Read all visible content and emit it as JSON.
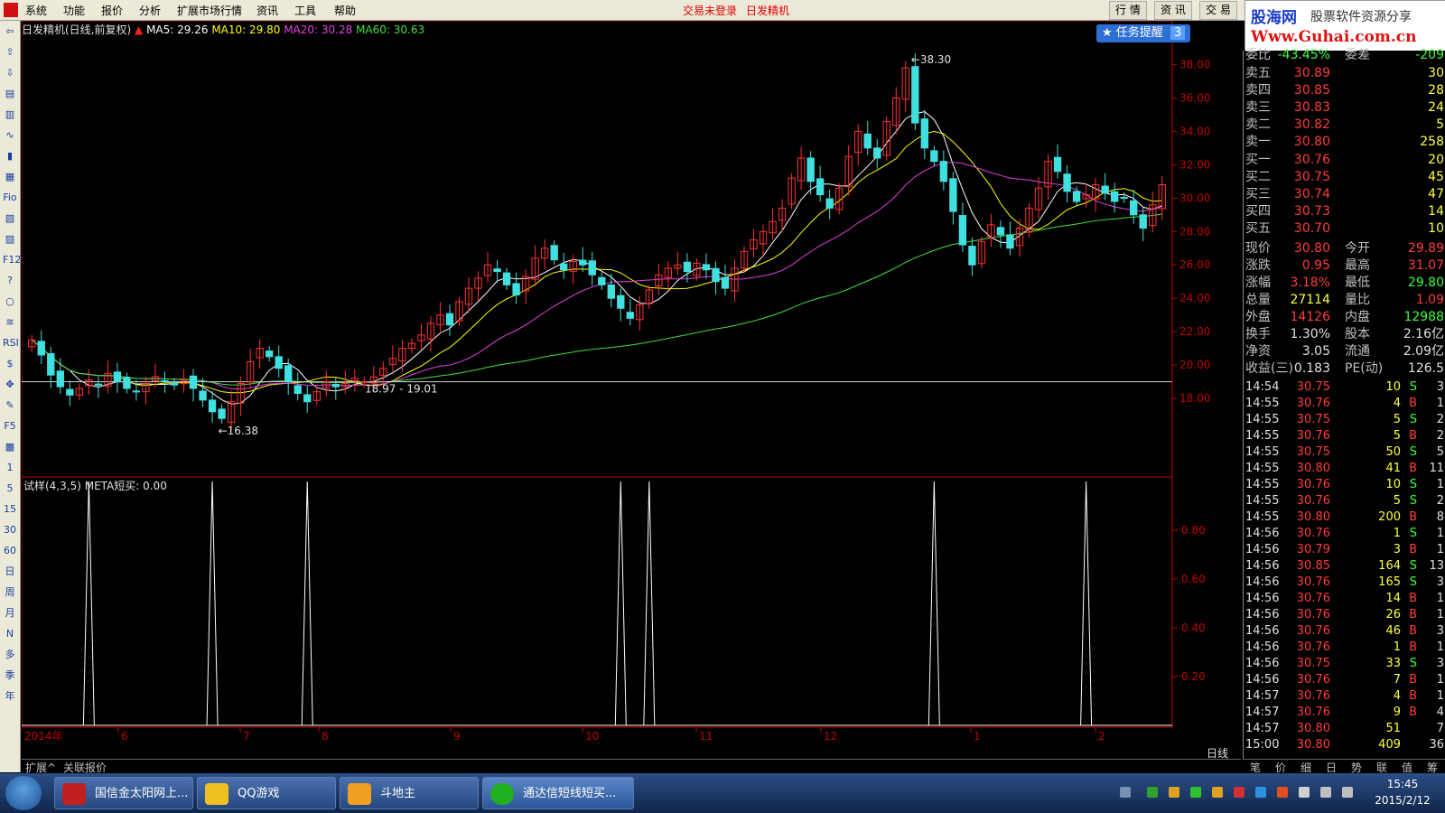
{
  "menu": {
    "items": [
      "系统",
      "功能",
      "报价",
      "分析",
      "扩展市场行情",
      "资讯",
      "工具",
      "帮助"
    ],
    "status_login": "交易未登录",
    "status_name": "日发精机",
    "right_tabs": [
      "行 情",
      "资 讯",
      "交 易"
    ]
  },
  "banner": {
    "line1": "股海网",
    "line1b": "股票软件资源分享",
    "line2": "Www.Guhai.com.cn"
  },
  "left_toolbar": [
    "⇦",
    "⇧",
    "⇩",
    "▤",
    "▥",
    "∿",
    "▮",
    "▦",
    "Fio",
    "▧",
    "▨",
    "F12",
    "?",
    "○",
    "≋",
    "RSI",
    "$",
    "✥",
    "✎",
    "F5",
    "▩",
    "1",
    "5",
    "15",
    "30",
    "60",
    "日",
    "周",
    "月",
    "N",
    "多",
    "季",
    "年"
  ],
  "chart": {
    "title": "日发精机(日线,前复权)",
    "ma5": "MA5: 29.26",
    "ma10": "MA10: 29.80",
    "ma20": "MA20: 30.28",
    "ma60": "MA60: 30.63",
    "task_label": "任务提醒",
    "task_count": "3",
    "high_label": "38.30",
    "low_label": "16.38",
    "range_label": "18.97 - 19.01",
    "indicator_label": "试样(4,3,5)  META短买: 0.00",
    "period_label": "日线",
    "colors": {
      "ma5": "#ffffff",
      "ma10": "#ffff00",
      "ma20": "#e040e0",
      "ma60": "#40e040",
      "up": "#ff3030",
      "down": "#40e0e0",
      "axis": "#c00000"
    }
  },
  "chart_data": [
    {
      "type": "candlestick",
      "title": "日发精机(日线,前复权)",
      "ylim": [
        16,
        39
      ],
      "y_ticks": [
        "38.00",
        "36.00",
        "34.00",
        "32.00",
        "30.00",
        "28.00",
        "26.00",
        "24.00",
        "22.00",
        "20.00",
        "18.00"
      ],
      "x_labels": [
        "2014年",
        "6",
        "7",
        "8",
        "9",
        "10",
        "11",
        "12",
        "1",
        "2"
      ],
      "close": [
        21.5,
        20.6,
        19.4,
        18.7,
        18.2,
        18.6,
        19.1,
        18.8,
        19.5,
        19.0,
        18.6,
        18.4,
        18.9,
        19.3,
        19.0,
        18.8,
        19.1,
        18.6,
        17.9,
        17.2,
        16.8,
        17.8,
        18.9,
        20.2,
        21.0,
        20.5,
        19.8,
        19.0,
        18.3,
        17.8,
        18.4,
        19.0,
        18.7,
        18.9,
        19.2,
        19.0,
        19.3,
        19.8,
        20.4,
        21.0,
        21.3,
        21.8,
        22.5,
        23.0,
        22.4,
        23.8,
        24.6,
        25.2,
        26.0,
        25.6,
        24.8,
        24.2,
        25.3,
        26.4,
        27.0,
        26.3,
        25.7,
        26.2,
        26.0,
        25.4,
        24.8,
        24.0,
        23.4,
        22.8,
        23.6,
        24.5,
        25.4,
        25.8,
        26.0,
        25.6,
        26.1,
        25.7,
        25.0,
        24.6,
        25.8,
        26.8,
        27.5,
        28.0,
        28.6,
        29.4,
        31.2,
        32.4,
        31.0,
        30.2,
        29.4,
        30.6,
        32.5,
        34.0,
        33.0,
        32.4,
        34.6,
        36.0,
        37.8,
        34.5,
        33.0,
        32.2,
        31.0,
        29.2,
        27.2,
        26.0,
        27.4,
        28.4,
        27.8,
        27.0,
        28.2,
        29.4,
        30.6,
        32.2,
        31.6,
        30.4,
        29.8,
        30.2,
        30.8,
        30.3,
        29.8,
        30.0,
        29.0,
        28.2,
        29.6,
        30.8
      ],
      "high": 38.3,
      "low": 16.38,
      "ma_values": {
        "MA5": 29.26,
        "MA10": 29.8,
        "MA20": 30.28,
        "MA60": 30.63
      }
    },
    {
      "type": "line",
      "title": "试样(4,3,5)  META短买: 0.00",
      "ylim": [
        0,
        1
      ],
      "y_ticks": [
        "0.80",
        "0.60",
        "0.40",
        "0.20"
      ],
      "spike_positions": [
        13,
        44,
        65,
        140,
        147,
        216,
        251
      ],
      "spike_value": 1.0
    }
  ],
  "quote": {
    "weibi": {
      "label": "委比",
      "value": "-43.45%",
      "label2": "委差",
      "value2": "-209"
    },
    "sell": [
      {
        "label": "卖五",
        "price": "30.89",
        "vol": "30"
      },
      {
        "label": "卖四",
        "price": "30.85",
        "vol": "28"
      },
      {
        "label": "卖三",
        "price": "30.83",
        "vol": "24"
      },
      {
        "label": "卖二",
        "price": "30.82",
        "vol": "5"
      },
      {
        "label": "卖一",
        "price": "30.80",
        "vol": "258"
      }
    ],
    "buy": [
      {
        "label": "买一",
        "price": "30.76",
        "vol": "20"
      },
      {
        "label": "买二",
        "price": "30.75",
        "vol": "45"
      },
      {
        "label": "买三",
        "price": "30.74",
        "vol": "47"
      },
      {
        "label": "买四",
        "price": "30.73",
        "vol": "14"
      },
      {
        "label": "买五",
        "price": "30.70",
        "vol": "10"
      }
    ],
    "stats": [
      {
        "l1": "现价",
        "v1": "30.80",
        "c1": "red",
        "l2": "今开",
        "v2": "29.89",
        "c2": "red"
      },
      {
        "l1": "涨跌",
        "v1": "0.95",
        "c1": "red",
        "l2": "最高",
        "v2": "31.07",
        "c2": "red"
      },
      {
        "l1": "涨幅",
        "v1": "3.18%",
        "c1": "red",
        "l2": "最低",
        "v2": "29.80",
        "c2": "grn"
      },
      {
        "l1": "总量",
        "v1": "27114",
        "c1": "yel",
        "l2": "量比",
        "v2": "1.09",
        "c2": "red"
      },
      {
        "l1": "外盘",
        "v1": "14126",
        "c1": "red",
        "l2": "内盘",
        "v2": "12988",
        "c2": "grn"
      },
      {
        "l1": "换手",
        "v1": "1.30%",
        "c1": "wht",
        "l2": "股本",
        "v2": "2.16亿",
        "c2": "wht"
      },
      {
        "l1": "净资",
        "v1": "3.05",
        "c1": "wht",
        "l2": "流通",
        "v2": "2.09亿",
        "c2": "wht"
      },
      {
        "l1": "收益(三)",
        "v1": "0.183",
        "c1": "wht",
        "l2": "PE(动)",
        "v2": "126.5",
        "c2": "wht"
      }
    ],
    "ticks": [
      {
        "t": "14:54",
        "p": "30.75",
        "v": "10",
        "s": "S",
        "n": "3"
      },
      {
        "t": "14:55",
        "p": "30.76",
        "v": "4",
        "s": "B",
        "n": "1"
      },
      {
        "t": "14:55",
        "p": "30.75",
        "v": "5",
        "s": "S",
        "n": "2"
      },
      {
        "t": "14:55",
        "p": "30.76",
        "v": "5",
        "s": "B",
        "n": "2"
      },
      {
        "t": "14:55",
        "p": "30.75",
        "v": "50",
        "s": "S",
        "n": "5"
      },
      {
        "t": "14:55",
        "p": "30.80",
        "v": "41",
        "s": "B",
        "n": "11"
      },
      {
        "t": "14:55",
        "p": "30.76",
        "v": "10",
        "s": "S",
        "n": "1"
      },
      {
        "t": "14:55",
        "p": "30.76",
        "v": "5",
        "s": "S",
        "n": "2"
      },
      {
        "t": "14:55",
        "p": "30.80",
        "v": "200",
        "s": "B",
        "n": "8"
      },
      {
        "t": "14:56",
        "p": "30.76",
        "v": "1",
        "s": "S",
        "n": "1"
      },
      {
        "t": "14:56",
        "p": "30.79",
        "v": "3",
        "s": "B",
        "n": "1"
      },
      {
        "t": "14:56",
        "p": "30.85",
        "v": "164",
        "s": "S",
        "n": "13"
      },
      {
        "t": "14:56",
        "p": "30.76",
        "v": "165",
        "s": "S",
        "n": "3"
      },
      {
        "t": "14:56",
        "p": "30.76",
        "v": "14",
        "s": "B",
        "n": "1"
      },
      {
        "t": "14:56",
        "p": "30.76",
        "v": "26",
        "s": "B",
        "n": "1"
      },
      {
        "t": "14:56",
        "p": "30.76",
        "v": "46",
        "s": "B",
        "n": "3"
      },
      {
        "t": "14:56",
        "p": "30.76",
        "v": "1",
        "s": "B",
        "n": "1"
      },
      {
        "t": "14:56",
        "p": "30.75",
        "v": "33",
        "s": "S",
        "n": "3"
      },
      {
        "t": "14:56",
        "p": "30.76",
        "v": "7",
        "s": "B",
        "n": "1"
      },
      {
        "t": "14:57",
        "p": "30.76",
        "v": "4",
        "s": "B",
        "n": "1"
      },
      {
        "t": "14:57",
        "p": "30.76",
        "v": "9",
        "s": "B",
        "n": "4"
      },
      {
        "t": "14:57",
        "p": "30.80",
        "v": "51",
        "s": "",
        "n": "7"
      },
      {
        "t": "15:00",
        "p": "30.80",
        "v": "409",
        "s": "",
        "n": "36"
      }
    ]
  },
  "bottom_tabs": [
    "扩展^",
    "关联报价"
  ],
  "right_bottom_tabs": [
    "笔",
    "价",
    "细",
    "日",
    "势",
    "联",
    "值",
    "筹"
  ],
  "taskbar": {
    "buttons": [
      "国信金太阳网上...",
      "QQ游戏",
      "斗地主",
      "通达信短线短买..."
    ],
    "time": "15:45",
    "date": "2015/2/12"
  }
}
